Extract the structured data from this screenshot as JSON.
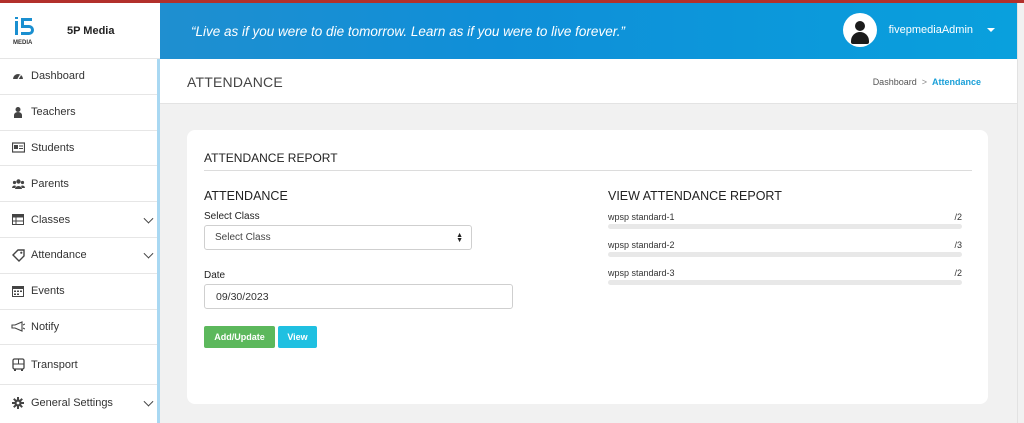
{
  "brand": {
    "name": "5P Media",
    "logo_text": "MEDIA"
  },
  "header": {
    "quote": "“Live as if you were to die tomorrow. Learn as if you were to live forever.”",
    "username": "fivepmediaAdmin"
  },
  "sidebar": {
    "items": [
      {
        "label": "Dashboard",
        "icon": "dashboard-icon"
      },
      {
        "label": "Teachers",
        "icon": "teacher-icon"
      },
      {
        "label": "Students",
        "icon": "id-card-icon"
      },
      {
        "label": "Parents",
        "icon": "users-icon"
      },
      {
        "label": "Classes",
        "icon": "table-icon"
      },
      {
        "label": "Attendance",
        "icon": "tag-icon"
      },
      {
        "label": "Events",
        "icon": "calendar-icon"
      },
      {
        "label": "Notify",
        "icon": "bullhorn-icon"
      },
      {
        "label": "Transport",
        "icon": "bus-icon"
      },
      {
        "label": "General Settings",
        "icon": "gear-icon"
      }
    ]
  },
  "page": {
    "title": "ATTENDANCE",
    "breadcrumb": {
      "home": "Dashboard",
      "separator": ">",
      "current": "Attendance"
    }
  },
  "card": {
    "title": "ATTENDANCE REPORT",
    "attendance": {
      "title": "ATTENDANCE",
      "class_label": "Select Class",
      "class_value": "Select Class",
      "date_label": "Date",
      "date_value": "09/30/2023",
      "add_update_label": "Add/Update",
      "view_label": "View"
    },
    "report": {
      "title": "VIEW ATTENDANCE REPORT",
      "rows": [
        {
          "name": "wpsp standard-1",
          "count": "/2"
        },
        {
          "name": "wpsp standard-2",
          "count": "/3"
        },
        {
          "name": "wpsp standard-3",
          "count": "/2"
        }
      ]
    }
  },
  "colors": {
    "header_gradient_start": "#1f8fd0",
    "header_gradient_end": "#09a0dd",
    "top_accent": "#b2302b",
    "breadcrumb_active": "#1ba0d8",
    "button_green": "#5cb85c",
    "button_cyan": "#1fc0e1"
  }
}
